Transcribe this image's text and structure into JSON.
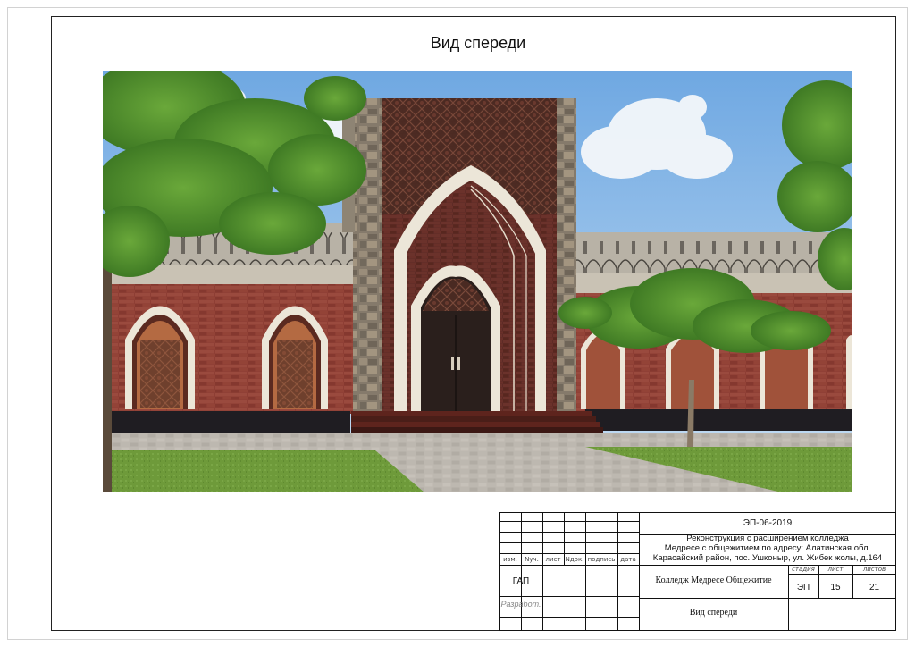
{
  "sheet": {
    "title": "Вид спереди"
  },
  "render": {
    "image_label": "architectural-render-front-view",
    "colors": {
      "sky": "#9cc8ef",
      "brick": "#8e3e34",
      "portal_stone": "#8a7e70",
      "arch_white": "#ece6d8",
      "door": "#2a1f1c",
      "lawn": "#6e9a3a",
      "paving": "#b8b4ae",
      "foliage": "#4e8b2a"
    }
  },
  "title_block": {
    "doc_code": "ЭП-06-2019",
    "project_line1": "Реконструкция с расширением колледжа",
    "project_line2": "Медресе с общежитием по адресу: Алатинская обл.",
    "project_line3": "Карасайский район, пос. Ушконыр, ул. Жибек жолы, д.164",
    "col_headers": [
      "изм.",
      "Nуч.",
      "лист",
      "Nдок.",
      "подпись",
      "дата"
    ],
    "stage_headers": [
      "стадия",
      "лист",
      "листов"
    ],
    "stage": "ЭП",
    "sheet_no": "15",
    "sheets_total": "21",
    "role_gap": "ГАП",
    "role_developed": "Разработ.",
    "object_name": "Колледж Медресе Общежитие",
    "drawing_name": "Вид спереди"
  }
}
